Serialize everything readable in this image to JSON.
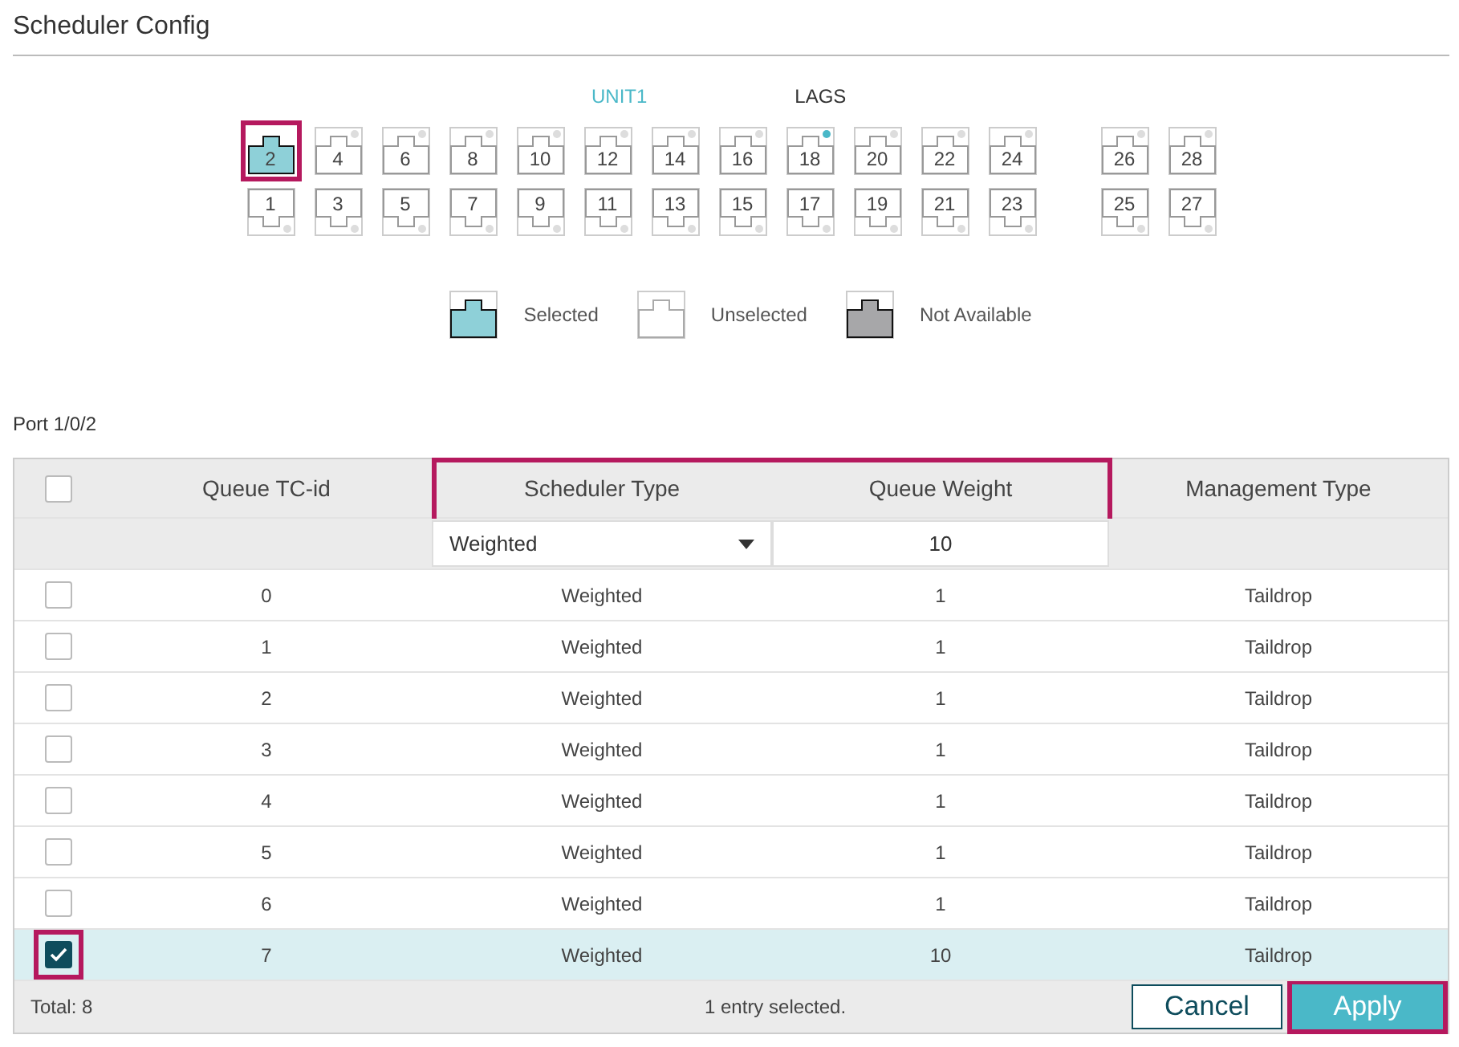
{
  "title": "Scheduler Config",
  "port_panel": {
    "groups": [
      {
        "label": "UNIT1",
        "selected": true
      },
      {
        "label": "LAGS",
        "selected": false
      }
    ],
    "top_row": [
      {
        "number": "2",
        "selected": true,
        "highlighted": true,
        "linked": false
      },
      {
        "number": "4",
        "selected": false,
        "highlighted": false,
        "linked": false
      },
      {
        "number": "6",
        "selected": false,
        "highlighted": false,
        "linked": false
      },
      {
        "number": "8",
        "selected": false,
        "highlighted": false,
        "linked": false
      },
      {
        "number": "10",
        "selected": false,
        "highlighted": false,
        "linked": false
      },
      {
        "number": "12",
        "selected": false,
        "highlighted": false,
        "linked": false
      },
      {
        "number": "14",
        "selected": false,
        "highlighted": false,
        "linked": false
      },
      {
        "number": "16",
        "selected": false,
        "highlighted": false,
        "linked": false
      },
      {
        "number": "18",
        "selected": false,
        "highlighted": false,
        "linked": true
      },
      {
        "number": "20",
        "selected": false,
        "highlighted": false,
        "linked": false
      },
      {
        "number": "22",
        "selected": false,
        "highlighted": false,
        "linked": false
      },
      {
        "number": "24",
        "selected": false,
        "highlighted": false,
        "linked": false
      },
      {
        "number": "26",
        "selected": false,
        "highlighted": false,
        "linked": false
      },
      {
        "number": "28",
        "selected": false,
        "highlighted": false,
        "linked": false
      }
    ],
    "bottom_row": [
      {
        "number": "1",
        "selected": false,
        "highlighted": false,
        "linked": false
      },
      {
        "number": "3",
        "selected": false,
        "highlighted": false,
        "linked": false
      },
      {
        "number": "5",
        "selected": false,
        "highlighted": false,
        "linked": false
      },
      {
        "number": "7",
        "selected": false,
        "highlighted": false,
        "linked": false
      },
      {
        "number": "9",
        "selected": false,
        "highlighted": false,
        "linked": false
      },
      {
        "number": "11",
        "selected": false,
        "highlighted": false,
        "linked": false
      },
      {
        "number": "13",
        "selected": false,
        "highlighted": false,
        "linked": false
      },
      {
        "number": "15",
        "selected": false,
        "highlighted": false,
        "linked": false
      },
      {
        "number": "17",
        "selected": false,
        "highlighted": false,
        "linked": false
      },
      {
        "number": "19",
        "selected": false,
        "highlighted": false,
        "linked": false
      },
      {
        "number": "21",
        "selected": false,
        "highlighted": false,
        "linked": false
      },
      {
        "number": "23",
        "selected": false,
        "highlighted": false,
        "linked": false
      },
      {
        "number": "25",
        "selected": false,
        "highlighted": false,
        "linked": false
      },
      {
        "number": "27",
        "selected": false,
        "highlighted": false,
        "linked": false
      }
    ],
    "legend": [
      {
        "kind": "selected",
        "label": "Selected"
      },
      {
        "kind": "unselected",
        "label": "Unselected"
      },
      {
        "kind": "unavailable",
        "label": "Not Available"
      }
    ]
  },
  "port_label": "Port 1/0/2",
  "table": {
    "columns": [
      {
        "label": "Queue TC-id"
      },
      {
        "label": "Scheduler Type"
      },
      {
        "label": "Queue Weight"
      },
      {
        "label": "Management Type"
      }
    ],
    "edit_columns_highlighted": true,
    "header_checked": false,
    "edit_row": {
      "scheduler_type": "Weighted",
      "queue_weight": "10"
    },
    "rows": [
      {
        "id": "0",
        "type": "Weighted",
        "weight": "1",
        "management": "Taildrop",
        "checked": false,
        "highlighted": false
      },
      {
        "id": "1",
        "type": "Weighted",
        "weight": "1",
        "management": "Taildrop",
        "checked": false,
        "highlighted": false
      },
      {
        "id": "2",
        "type": "Weighted",
        "weight": "1",
        "management": "Taildrop",
        "checked": false,
        "highlighted": false
      },
      {
        "id": "3",
        "type": "Weighted",
        "weight": "1",
        "management": "Taildrop",
        "checked": false,
        "highlighted": false
      },
      {
        "id": "4",
        "type": "Weighted",
        "weight": "1",
        "management": "Taildrop",
        "checked": false,
        "highlighted": false
      },
      {
        "id": "5",
        "type": "Weighted",
        "weight": "1",
        "management": "Taildrop",
        "checked": false,
        "highlighted": false
      },
      {
        "id": "6",
        "type": "Weighted",
        "weight": "1",
        "management": "Taildrop",
        "checked": false,
        "highlighted": false
      },
      {
        "id": "7",
        "type": "Weighted",
        "weight": "10",
        "management": "Taildrop",
        "checked": true,
        "highlighted": true
      }
    ],
    "total": "Total: 8",
    "selection": "1 entry selected."
  },
  "buttons": [
    {
      "label": "Cancel",
      "kind": "secondary",
      "highlighted": false
    },
    {
      "label": "Apply",
      "kind": "primary",
      "highlighted": true
    }
  ]
}
